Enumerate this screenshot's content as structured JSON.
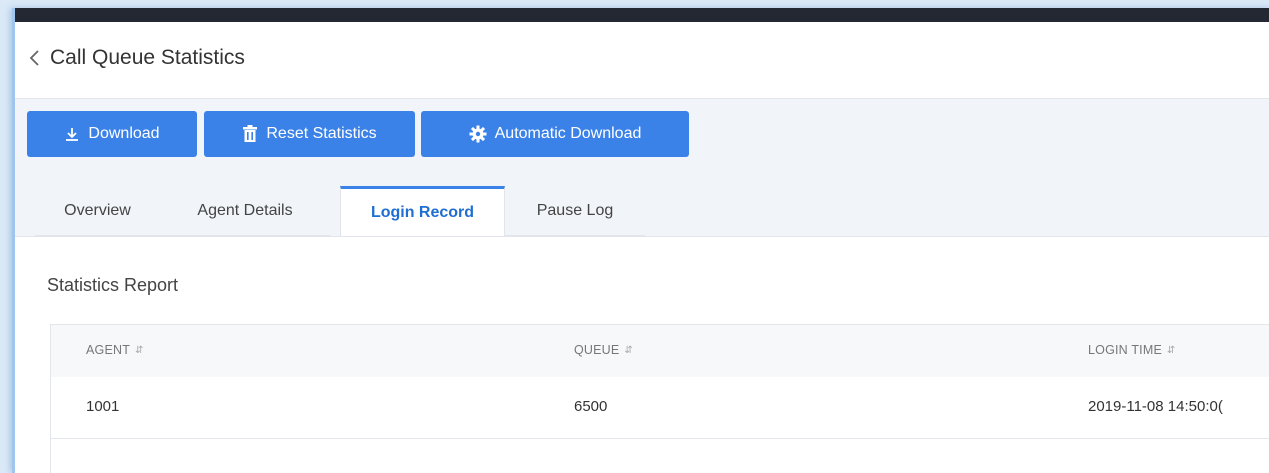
{
  "header": {
    "title": "Call Queue Statistics"
  },
  "toolbar": {
    "download_label": "Download",
    "reset_label": "Reset Statistics",
    "auto_download_label": "Automatic Download"
  },
  "tabs": [
    {
      "label": "Overview",
      "active": false
    },
    {
      "label": "Agent Details",
      "active": false
    },
    {
      "label": "Login Record",
      "active": true
    },
    {
      "label": "Pause Log",
      "active": false
    }
  ],
  "report": {
    "title": "Statistics Report",
    "columns": [
      "AGENT",
      "QUEUE",
      "LOGIN TIME"
    ],
    "rows": [
      {
        "agent": "1001",
        "queue": "6500",
        "login_time": "2019-11-08 14:50:0("
      }
    ]
  },
  "icons": {
    "back": "chevron-left-icon",
    "download": "download-icon",
    "reset": "trash-icon",
    "auto_download": "gear-icon",
    "sort": "sort-icon"
  },
  "colors": {
    "primary": "#3b82e8",
    "active_tab_text": "#1e6fd1",
    "topbar": "#232833"
  }
}
